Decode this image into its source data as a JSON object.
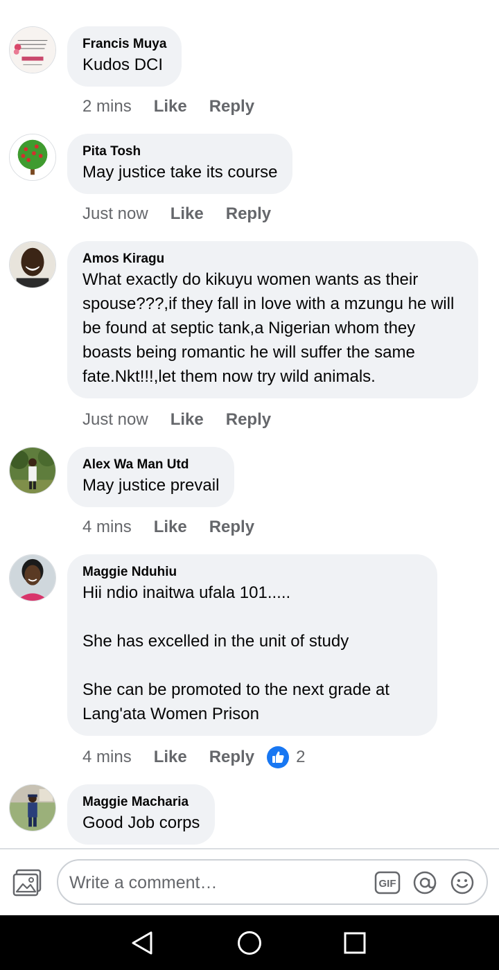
{
  "comments": [
    {
      "author": "Francis Muya",
      "text": "Kudos DCI",
      "time": "2 mins",
      "like": "Like",
      "reply": "Reply",
      "avatar": "quote-card-avatar"
    },
    {
      "author": "Pita Tosh",
      "text": "May justice take its course",
      "time": "Just now",
      "like": "Like",
      "reply": "Reply",
      "avatar": "tree-avatar"
    },
    {
      "author": "Amos Kiragu",
      "text": "What exactly do kikuyu women wants as their spouse???,if they fall in love with a mzungu he will be found at septic tank,a Nigerian whom they boasts being romantic he will suffer the same fate.Nkt!!!,let them now try wild animals.",
      "time": "Just now",
      "like": "Like",
      "reply": "Reply",
      "avatar": "man-portrait-avatar"
    },
    {
      "author": "Alex Wa Man Utd",
      "text": "May justice prevail",
      "time": "4 mins",
      "like": "Like",
      "reply": "Reply",
      "avatar": "outdoor-person-avatar"
    },
    {
      "author": "Maggie Nduhiu",
      "text": "Hii ndio inaitwa ufala 101.....\n\nShe has excelled in the unit of study\n\nShe can be promoted to the next grade at Lang'ata Women Prison",
      "time": "4 mins",
      "like": "Like",
      "reply": "Reply",
      "reaction_count": "2",
      "reaction_icon": "thumbs-up-icon",
      "avatar": "woman-portrait-avatar"
    },
    {
      "author": "Maggie Macharia",
      "text": "Good Job corps",
      "avatar": "uniformed-person-avatar"
    }
  ],
  "composer": {
    "placeholder": "Write a comment…",
    "icons": [
      "photo-gallery-icon",
      "gif-icon",
      "mention-icon",
      "emoji-icon"
    ]
  },
  "navbar": {
    "icons": [
      "back-triangle-icon",
      "home-circle-icon",
      "recents-square-icon"
    ]
  },
  "colors": {
    "accent": "#1877f2",
    "bubble": "#f0f2f5",
    "secondary_text": "#65676b"
  }
}
